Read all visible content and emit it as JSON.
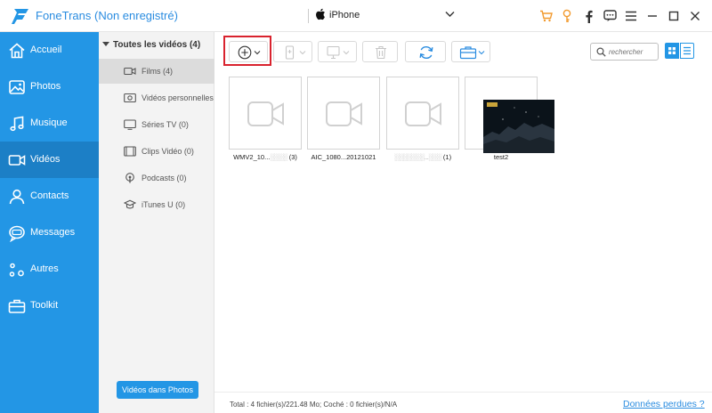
{
  "app": {
    "title": "FoneTrans (Non enregistré)",
    "device": "iPhone",
    "accent": "#2396e5",
    "active_nav": "#1c7fc6",
    "cart_color": "#f29a2e"
  },
  "sidebar": {
    "items": [
      {
        "label": "Accueil",
        "icon": "home-icon"
      },
      {
        "label": "Photos",
        "icon": "photo-icon"
      },
      {
        "label": "Musique",
        "icon": "music-icon"
      },
      {
        "label": "Vidéos",
        "icon": "video-icon",
        "active": true
      },
      {
        "label": "Contacts",
        "icon": "contacts-icon"
      },
      {
        "label": "Messages",
        "icon": "messages-icon"
      },
      {
        "label": "Autres",
        "icon": "others-icon"
      },
      {
        "label": "Toolkit",
        "icon": "toolkit-icon"
      }
    ]
  },
  "categories": {
    "header": "Toutes les vidéos (4)",
    "items": [
      {
        "label": "Films (4)",
        "icon": "film-icon",
        "active": true
      },
      {
        "label": "Vidéos personnelles ...",
        "icon": "home-video-icon"
      },
      {
        "label": "Séries TV (0)",
        "icon": "tv-icon"
      },
      {
        "label": "Clips Vidéo (0)",
        "icon": "clip-icon"
      },
      {
        "label": "Podcasts (0)",
        "icon": "podcast-icon"
      },
      {
        "label": "iTunes U (0)",
        "icon": "itunes-u-icon"
      }
    ],
    "button": "Vidéos dans Photos"
  },
  "search": {
    "placeholder": "rechercher"
  },
  "videos": [
    {
      "name_start": "WMV2_10...",
      "name_end": "(3)"
    },
    {
      "name_start": "AIC_1080...20121021",
      "name_end": ""
    },
    {
      "name_start": "",
      "name_end": "(1)"
    },
    {
      "name_start": "test2",
      "name_end": ""
    }
  ],
  "status": {
    "summary": "Total : 4 fichier(s)/221.48 Mo; Coché : 0 fichier(s)/N/A",
    "lost_link": "Données perdues ?"
  }
}
